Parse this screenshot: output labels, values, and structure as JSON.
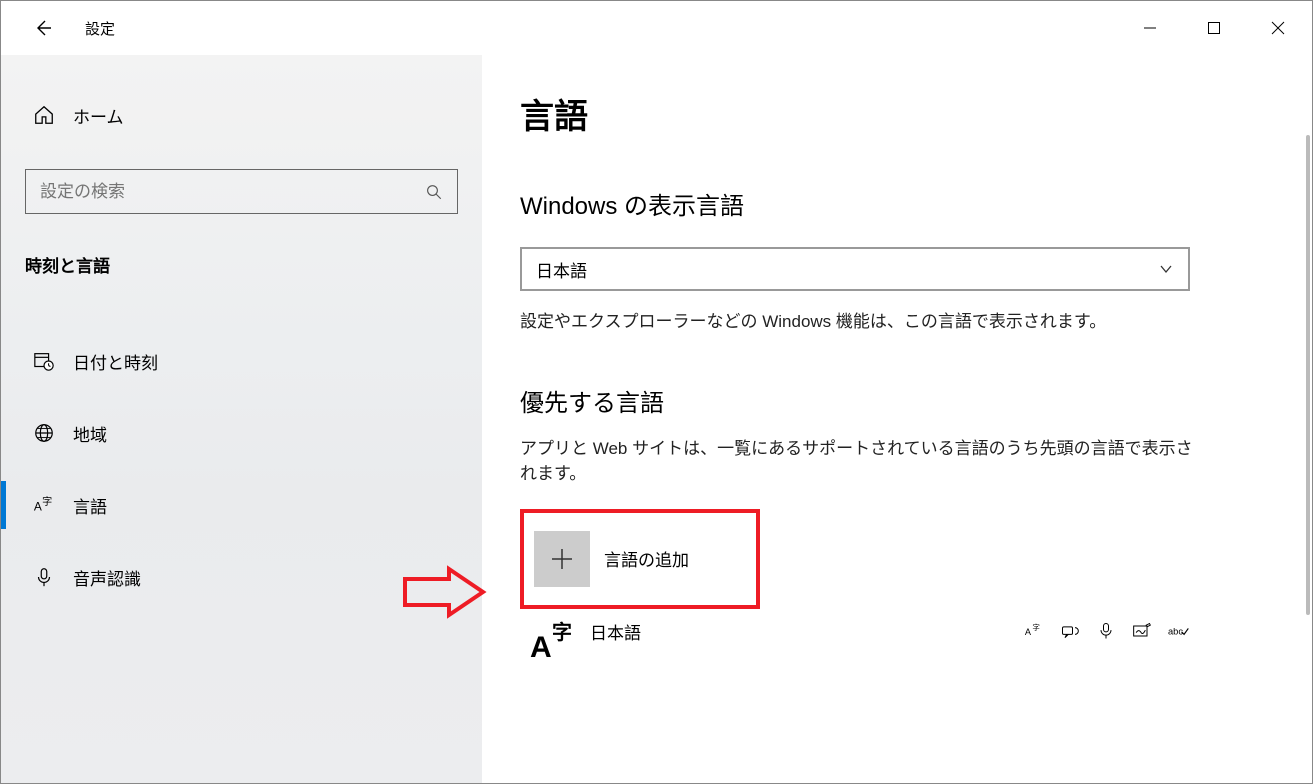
{
  "app": {
    "title": "設定"
  },
  "sidebar": {
    "home": "ホーム",
    "search_placeholder": "設定の検索",
    "category": "時刻と言語",
    "items": [
      {
        "label": "日付と時刻",
        "icon": "calendar-clock-icon"
      },
      {
        "label": "地域",
        "icon": "globe-icon"
      },
      {
        "label": "言語",
        "icon": "language-icon",
        "selected": true
      },
      {
        "label": "音声認識",
        "icon": "microphone-icon"
      }
    ]
  },
  "main": {
    "title": "言語",
    "display_language": {
      "heading": "Windows の表示言語",
      "selected": "日本語",
      "description": "設定やエクスプローラーなどの Windows 機能は、この言語で表示されます。"
    },
    "preferred": {
      "heading": "優先する言語",
      "description": "アプリと Web サイトは、一覧にあるサポートされている言語のうち先頭の言語で表示されます。",
      "add_label": "言語の追加",
      "languages": [
        {
          "name": "日本語",
          "features": [
            "display-language-icon",
            "tts-icon",
            "speech-icon",
            "handwriting-icon",
            "spellcheck-icon"
          ]
        }
      ]
    }
  }
}
